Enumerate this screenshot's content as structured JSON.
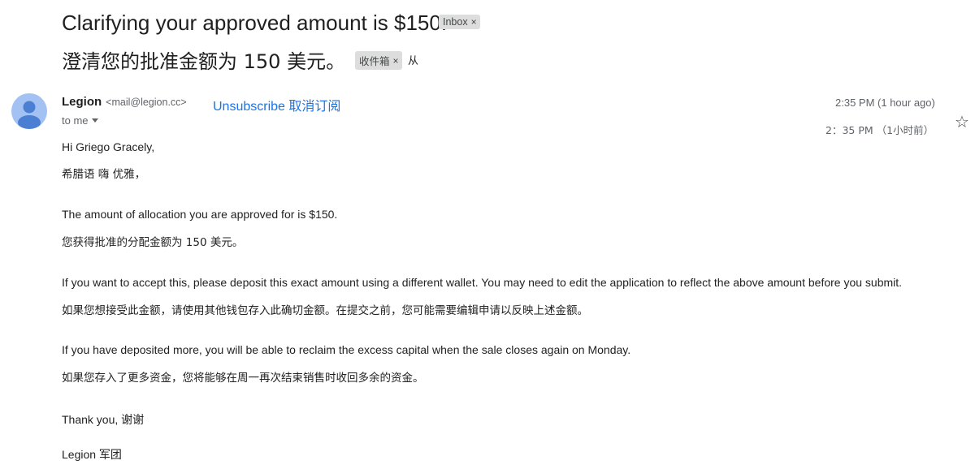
{
  "email": {
    "subject": "Clarifying your approved amount is $150.",
    "subject_cn": "澄清您的批准金额为 150 美元。",
    "label_inbox": "Inbox",
    "label_inbox_cn": "收件箱",
    "label_after_cn": "从",
    "sender": {
      "name": "Legion",
      "email": "<mail@legion.cc>",
      "unsubscribe": "Unsubscribe 取消订阅",
      "to_me": "to me"
    },
    "time": "2:35 PM (1 hour ago)",
    "time_cn": "2：35 PM （1小时前）",
    "body": [
      {
        "en": "Hi Griego Gracely,",
        "cn": "希腊语 嗨 优雅，"
      },
      {
        "en": "The amount of allocation you are approved for is $150.",
        "cn": "您获得批准的分配金额为 150 美元。"
      },
      {
        "en": "If you want to accept this, please deposit this exact amount using a different wallet. You may need to edit the application to reflect the above amount before you submit.",
        "cn": "如果您想接受此金额，请使用其他钱包存入此确切金额。在提交之前，您可能需要编辑申请以反映上述金额。"
      },
      {
        "en": "If you have deposited more, you will be able to reclaim the excess capital when the sale closes again on Monday.",
        "cn": "如果您存入了更多资金，您将能够在周一再次结束销售时收回多余的资金。"
      }
    ],
    "closing": "Thank you, 谢谢",
    "signature": "Legion  军团"
  },
  "icons": {
    "close": "×",
    "star": "☆"
  }
}
